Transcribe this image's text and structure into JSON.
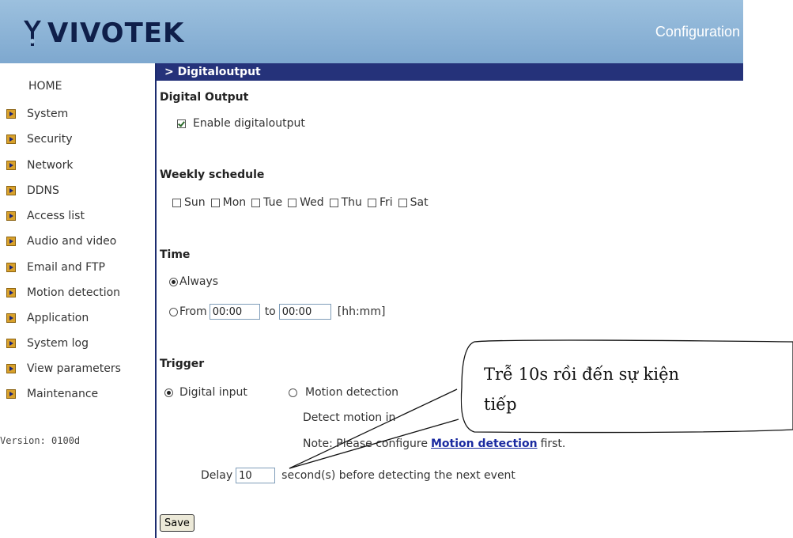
{
  "header": {
    "brand": "VIVOTEK",
    "title": "Configuration"
  },
  "sidebar": {
    "home": "HOME",
    "items": [
      {
        "label": "System"
      },
      {
        "label": "Security"
      },
      {
        "label": "Network"
      },
      {
        "label": "DDNS"
      },
      {
        "label": "Access list"
      },
      {
        "label": "Audio and video"
      },
      {
        "label": "Email and FTP"
      },
      {
        "label": "Motion detection"
      },
      {
        "label": "Application"
      },
      {
        "label": "System log"
      },
      {
        "label": "View parameters"
      },
      {
        "label": "Maintenance"
      }
    ],
    "version": "Version: 0100d"
  },
  "page": {
    "breadcrumb": "> Digitaloutput",
    "digital_output_title": "Digital Output",
    "enable_label": "Enable digitaloutput",
    "enable_checked": true,
    "weekly_title": "Weekly schedule",
    "days": [
      "Sun",
      "Mon",
      "Tue",
      "Wed",
      "Thu",
      "Fri",
      "Sat"
    ],
    "time_title": "Time",
    "always_label": "Always",
    "from_label": "From",
    "from_value": "00:00",
    "to_label": "to",
    "to_value": "00:00",
    "format_hint": "[hh:mm]",
    "trigger_title": "Trigger",
    "digital_input_label": "Digital input",
    "motion_detection_label": "Motion detection",
    "detect_motion_text": "Detect motion in",
    "note_prefix": "Note: Please configure",
    "note_link": "Motion detection",
    "note_suffix": "first.",
    "delay_label": "Delay",
    "delay_value": "10",
    "delay_suffix": "second(s) before detecting the next event",
    "save_label": "Save"
  },
  "callout": {
    "line1": "Trễ 10s rồi đến sự kiện",
    "line2": "tiếp"
  }
}
